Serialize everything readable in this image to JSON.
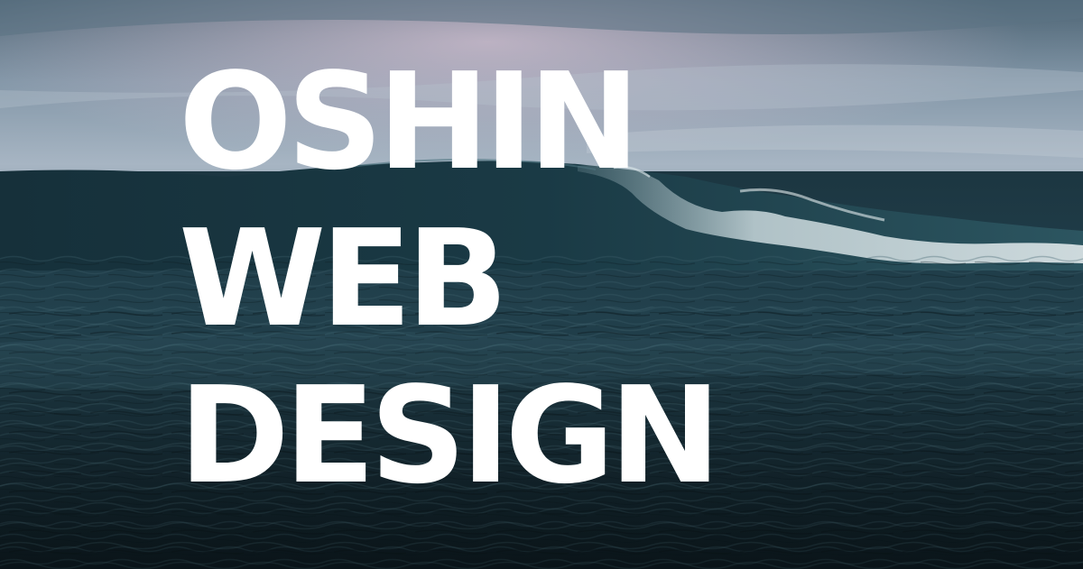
{
  "hero": {
    "title_lines": [
      "OSHIN",
      "WEB",
      "DESIGN"
    ],
    "text_color": "#ffffff",
    "palette": {
      "sky_top": "#4f6677",
      "sky_light": "#a9b8c7",
      "sky_pink": "#c9b9cc",
      "horizon": "#8ea3b3",
      "sea_deep": "#13252e",
      "sea_mid": "#1f3d49",
      "wave_foam": "#c7d6da"
    }
  }
}
